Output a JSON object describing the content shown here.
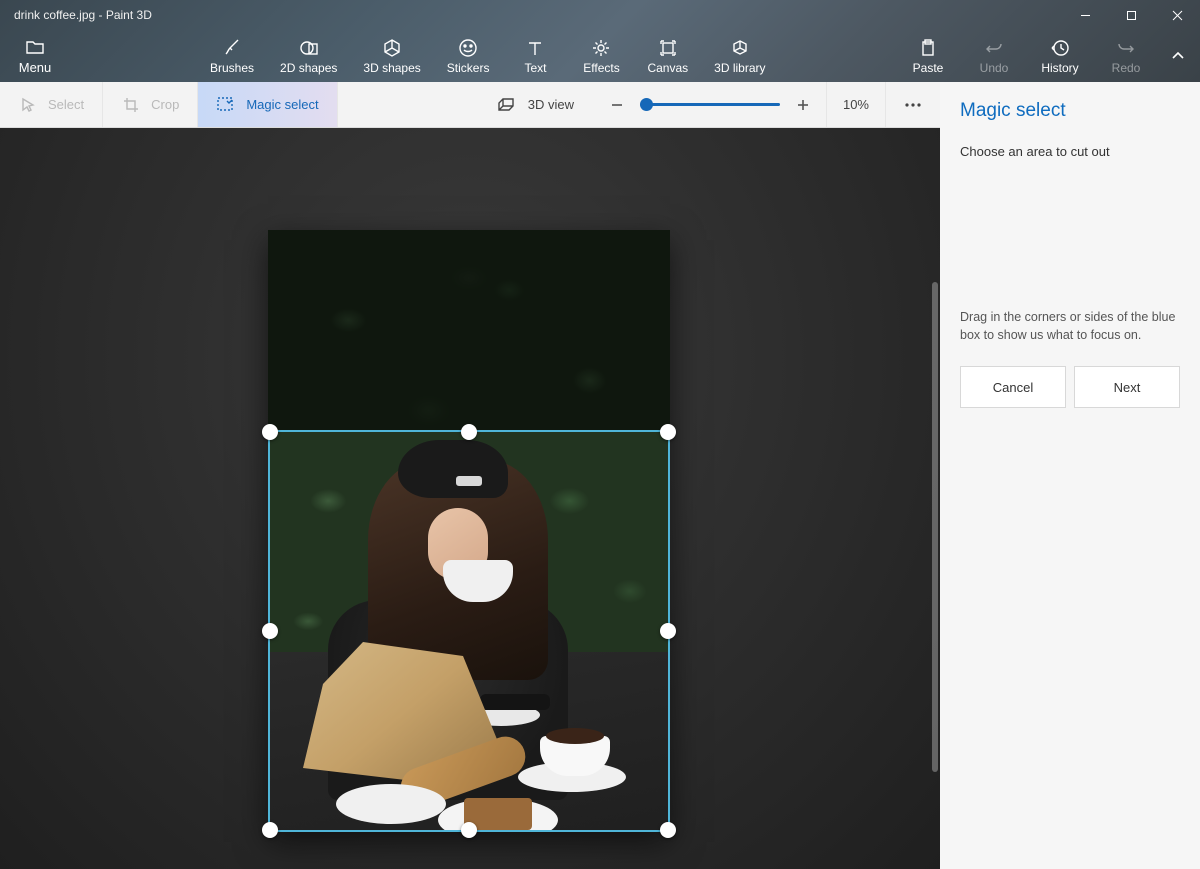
{
  "window": {
    "title": "drink coffee.jpg - Paint 3D"
  },
  "menu": {
    "label": "Menu"
  },
  "ribbon": {
    "brushes": "Brushes",
    "shapes2d": "2D shapes",
    "shapes3d": "3D shapes",
    "stickers": "Stickers",
    "text": "Text",
    "effects": "Effects",
    "canvas": "Canvas",
    "lib3d": "3D library",
    "paste": "Paste",
    "undo": "Undo",
    "history": "History",
    "redo": "Redo"
  },
  "subbar": {
    "select": "Select",
    "crop": "Crop",
    "magic_select": "Magic select",
    "view3d": "3D view",
    "zoom_pct": "10%"
  },
  "panel": {
    "title": "Magic select",
    "subtitle": "Choose an area to cut out",
    "desc": "Drag in the corners or sides of the blue box to show us what to focus on.",
    "cancel": "Cancel",
    "next": "Next"
  }
}
